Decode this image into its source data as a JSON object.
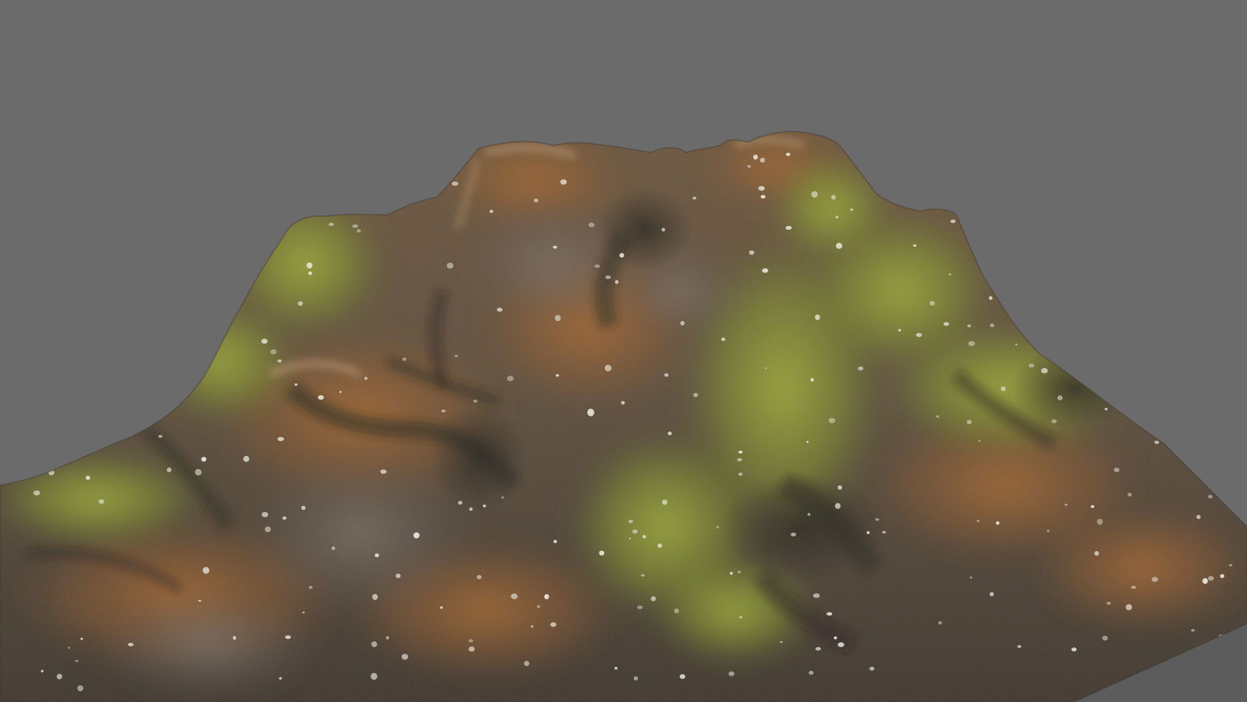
{
  "viewport": {
    "background_color": "#6b6b6b"
  },
  "subject": {
    "kind": "rock-mound-3d-scan",
    "palette": {
      "rust_orange": "#8a5a2c",
      "moss_green": "#8a9a2c",
      "moss_dark": "#4d5620",
      "rock_gray": "#5e554c",
      "shadow": "#2b2620",
      "lichen_white": "#e8e6dc"
    }
  }
}
